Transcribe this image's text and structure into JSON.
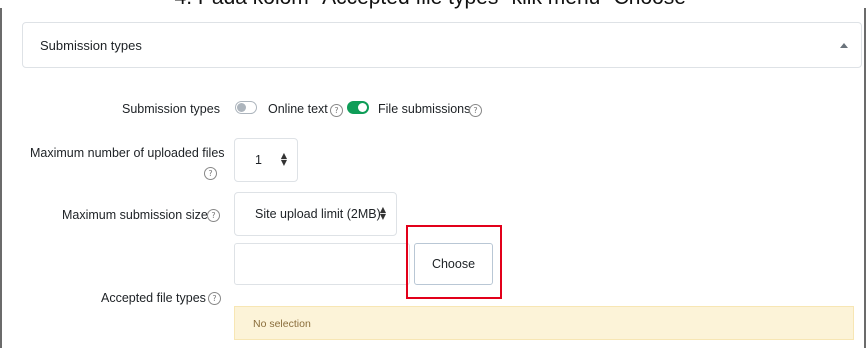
{
  "caption": "4.  Pada kolom \"Accepted file types\" klik menu \"Choose\"",
  "section": {
    "title": "Submission types",
    "expanded": true
  },
  "help_glyph": "?",
  "submission_types": {
    "label": "Submission types",
    "options": [
      {
        "label": "Online text",
        "enabled": false
      },
      {
        "label": "File submissions",
        "enabled": true
      }
    ]
  },
  "max_files": {
    "label_line1": "Maximum number of uploaded files",
    "value": "1"
  },
  "max_size": {
    "label": "Maximum submission size",
    "value": "Site upload limit (2MB)"
  },
  "accepted_types": {
    "label": "Accepted file types",
    "input_value": "",
    "choose_label": "Choose",
    "notice": "No selection"
  },
  "colors": {
    "toggle_on": "#0f9d58",
    "highlight": "#e2001a",
    "notice_bg": "#fcf3d8"
  }
}
